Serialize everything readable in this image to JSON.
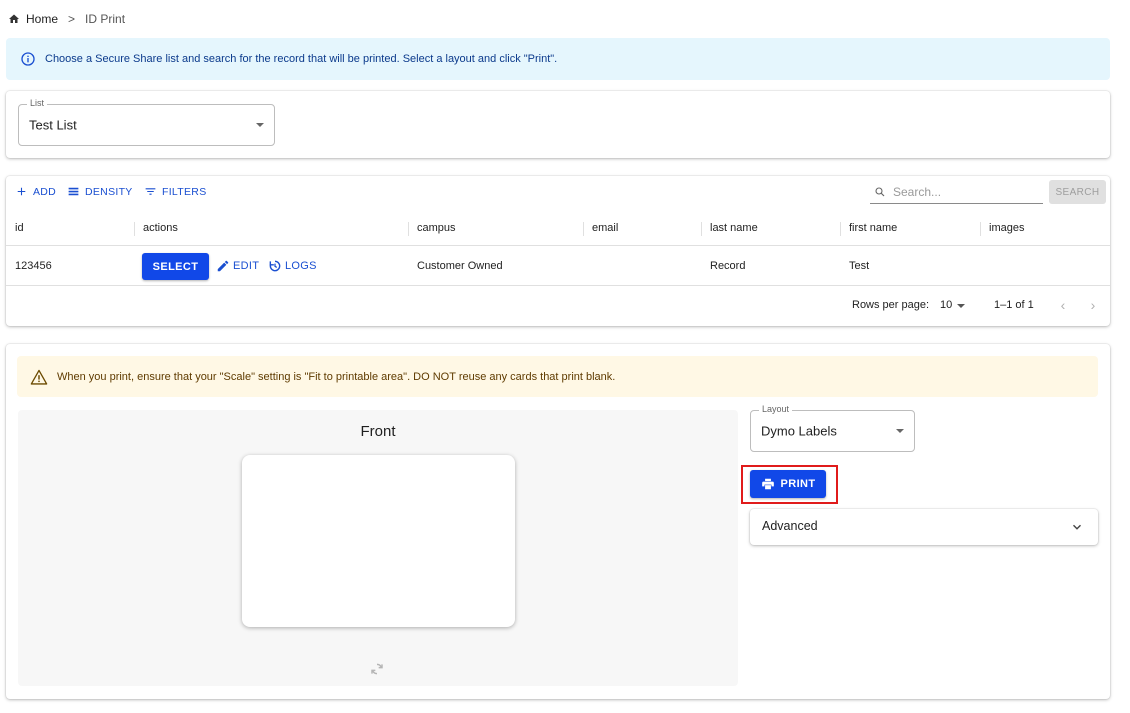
{
  "breadcrumb": {
    "home": "Home",
    "separator": ">",
    "current": "ID Print"
  },
  "info_alert": {
    "text": "Choose a Secure Share list and search for the record that will be printed. Select a layout and click \"Print\"."
  },
  "list_select": {
    "legend": "List",
    "value": "Test List"
  },
  "toolbar": {
    "add": "ADD",
    "density": "DENSITY",
    "filters": "FILTERS",
    "search_placeholder": "Search...",
    "search_button": "SEARCH"
  },
  "grid": {
    "columns": [
      "id",
      "actions",
      "campus",
      "email",
      "last name",
      "first name",
      "images"
    ],
    "rows": [
      {
        "id": "123456",
        "select": "SELECT",
        "edit": "EDIT",
        "logs": "LOGS",
        "campus": "Customer Owned",
        "email": "",
        "last_name": "Record",
        "first_name": "Test",
        "images": ""
      }
    ]
  },
  "pagination": {
    "rows_per_page_label": "Rows per page:",
    "rows_per_page": "10",
    "range": "1–1 of 1"
  },
  "warning_alert": {
    "text": "When you print, ensure that your \"Scale\" setting is \"Fit to printable area\". DO NOT reuse any cards that print blank."
  },
  "preview": {
    "title": "Front"
  },
  "layout_select": {
    "legend": "Layout",
    "value": "Dymo Labels"
  },
  "print_button": {
    "label": "PRINT"
  },
  "advanced": {
    "label": "Advanced"
  },
  "colors": {
    "primary": "#1148e8",
    "link": "#1a4fd1",
    "info_bg": "#e5f6fd",
    "warning_bg": "#fff8e5",
    "highlight": "#e01b1b"
  }
}
